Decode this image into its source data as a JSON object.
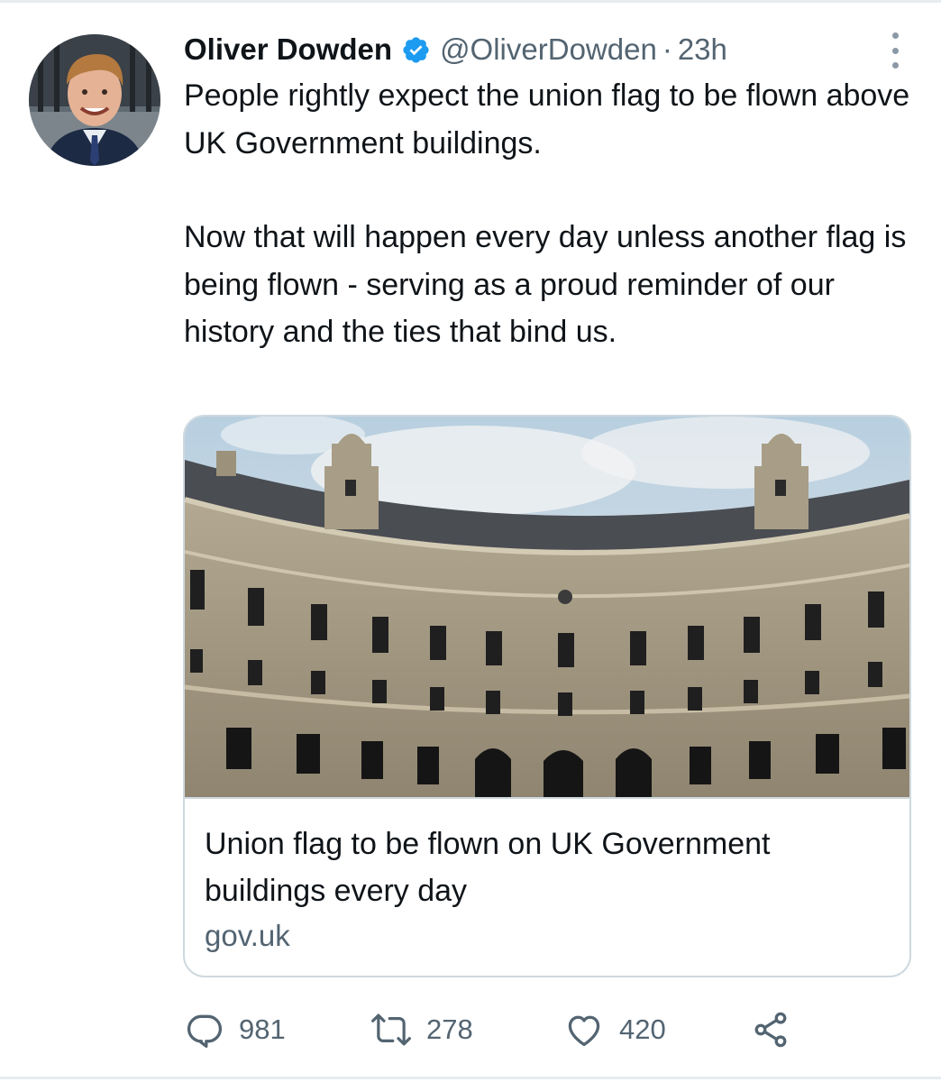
{
  "tweet": {
    "display_name": "Oliver Dowden",
    "handle": "@OliverDowden",
    "separator": "·",
    "time": "23h",
    "paragraphs": [
      "People rightly expect the union flag to be flown above UK Government buildings.",
      "Now that will happen every day unless another flag is being flown - serving as a proud reminder of our history and the ties that bind us."
    ]
  },
  "card": {
    "title": "Union flag to be flown on UK Government buildings every day",
    "domain": "gov.uk"
  },
  "actions": {
    "replies": "981",
    "retweets": "278",
    "likes": "420"
  },
  "colors": {
    "verified_badge": "#1d9bf0",
    "secondary_text": "#536471",
    "border": "#cfd9de",
    "action_icon": "#536471"
  },
  "icons": {
    "more": "more-vertical-icon",
    "reply": "reply-icon",
    "retweet": "retweet-icon",
    "like": "heart-icon",
    "share": "share-icon",
    "verified": "verified-badge-icon"
  }
}
